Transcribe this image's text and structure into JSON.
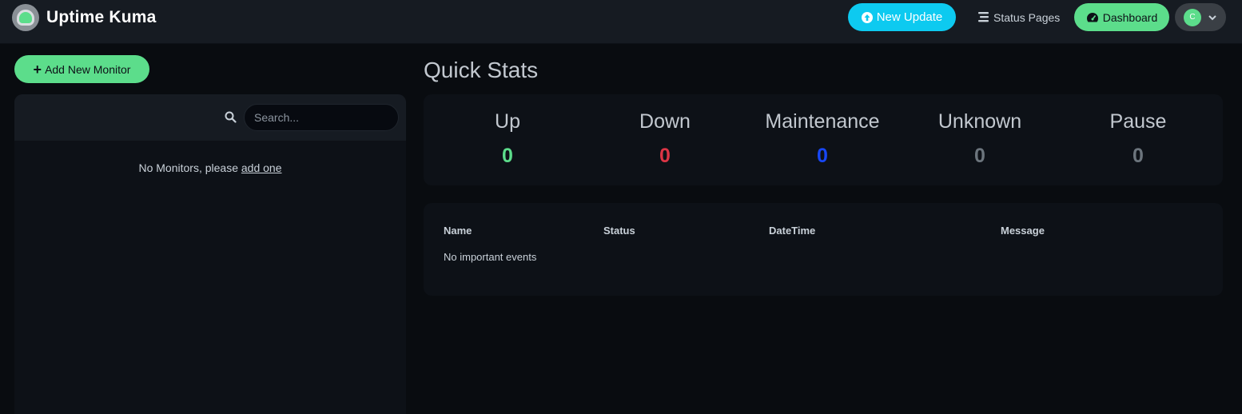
{
  "app": {
    "title": "Uptime Kuma"
  },
  "header": {
    "new_update_label": "New Update",
    "status_pages_label": "Status Pages",
    "dashboard_label": "Dashboard",
    "avatar_initial": "C"
  },
  "sidebar": {
    "add_monitor_label": "Add New Monitor",
    "search_placeholder": "Search...",
    "empty_text": "No Monitors, please",
    "empty_link": "add one"
  },
  "quick_stats": {
    "title": "Quick Stats",
    "items": [
      {
        "label": "Up",
        "value": "0",
        "color": "#5cdd8b"
      },
      {
        "label": "Down",
        "value": "0",
        "color": "#dc3545"
      },
      {
        "label": "Maintenance",
        "value": "0",
        "color": "#1747f5"
      },
      {
        "label": "Unknown",
        "value": "0",
        "color": "#6c757d"
      },
      {
        "label": "Pause",
        "value": "0",
        "color": "#6c757d"
      }
    ]
  },
  "events": {
    "columns": [
      "Name",
      "Status",
      "DateTime",
      "Message"
    ],
    "empty_text": "No important events"
  },
  "colors": {
    "primary": "#5cdd8b",
    "info": "#0dcaf0",
    "background": "#090c10",
    "surface": "#0d1117",
    "header": "#161b22"
  }
}
